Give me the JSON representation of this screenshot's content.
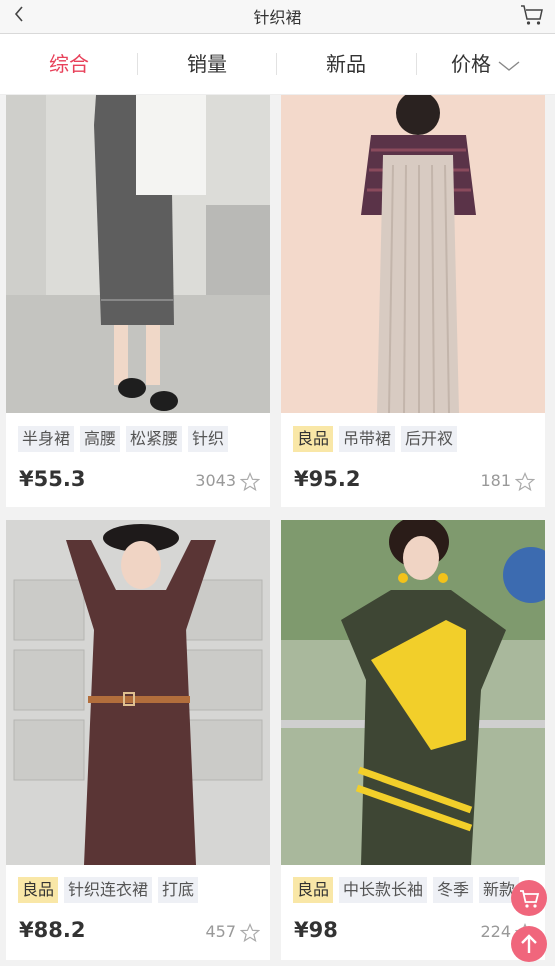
{
  "header": {
    "title": "针织裙",
    "back_icon": "chevron-left-icon",
    "cart_icon": "cart-icon"
  },
  "tabs": [
    {
      "label": "综合",
      "active": true
    },
    {
      "label": "销量",
      "active": false
    },
    {
      "label": "新品",
      "active": false
    },
    {
      "label": "价格",
      "active": false,
      "icon": "chevron-down-icon"
    }
  ],
  "products": [
    {
      "tags": [
        "半身裙",
        "高腰",
        "松紧腰",
        "针织"
      ],
      "good": false,
      "price": "¥55.3",
      "sales": "3043"
    },
    {
      "tags": [
        "良品",
        "吊带裙",
        "后开衩"
      ],
      "good": true,
      "price": "¥95.2",
      "sales": "181"
    },
    {
      "tags": [
        "良品",
        "针织连衣裙",
        "打底"
      ],
      "good": true,
      "price": "¥88.2",
      "sales": "457"
    },
    {
      "tags": [
        "良品",
        "中长款长袖",
        "冬季",
        "新款"
      ],
      "good": true,
      "price": "¥98",
      "sales": "224"
    }
  ],
  "colors": {
    "accent": "#e8415a",
    "good_tag": "#f9e7a7",
    "tag_bg": "#eef0f5",
    "float": "#f0667c"
  }
}
